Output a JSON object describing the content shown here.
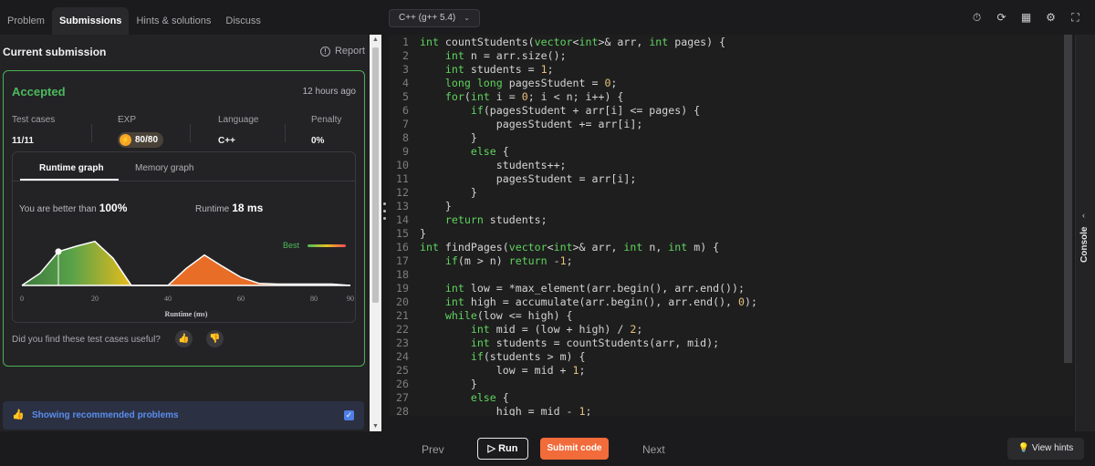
{
  "tabs": [
    {
      "label": "Problem"
    },
    {
      "label": "Submissions"
    },
    {
      "label": "Hints & solutions"
    },
    {
      "label": "Discuss"
    }
  ],
  "submission": {
    "title": "Current submission",
    "report": "Report",
    "status": "Accepted",
    "time": "12 hours ago",
    "stats": {
      "test_cases_label": "Test cases",
      "test_cases": "11/11",
      "exp_label": "EXP",
      "exp": "80/80",
      "language_label": "Language",
      "language": "C++",
      "penalty_label": "Penalty",
      "penalty": "0%"
    },
    "graph_tabs": [
      "Runtime graph",
      "Memory graph"
    ],
    "better_label": "You are better than",
    "better_value": "100%",
    "runtime_label": "Runtime",
    "runtime_value": "18 ms",
    "useful_question": "Did you find these test cases useful?",
    "recommend": "Showing recommended problems"
  },
  "chart_data": {
    "type": "area",
    "xlabel": "Runtime (ms)",
    "ylabel": "",
    "xlim": [
      0,
      90
    ],
    "x_ticks": [
      0,
      20,
      40,
      60,
      80,
      90
    ],
    "legend": "Best",
    "series": [
      {
        "x": [
          0,
          5,
          10,
          15,
          20,
          25,
          30,
          35,
          40,
          45,
          50,
          55,
          60,
          65,
          70,
          75,
          80,
          85,
          90
        ],
        "values": [
          0,
          18,
          50,
          58,
          65,
          40,
          0,
          0,
          0,
          25,
          45,
          28,
          12,
          3,
          2,
          2,
          2,
          2,
          0
        ]
      }
    ],
    "highlight": {
      "x": 10,
      "y": 50
    },
    "colors": {
      "green": "#4caf50",
      "yellow": "#e8c21f",
      "orange": "#f27127",
      "best": "#4cba5c"
    }
  },
  "editor": {
    "language": "C++ (g++ 5.4)",
    "lines": [
      "int countStudents(vector<int>& arr, int pages) {",
      "    int n = arr.size();",
      "    int students = 1;",
      "    long long pagesStudent = 0;",
      "    for(int i = 0; i < n; i++) {",
      "        if(pagesStudent + arr[i] <= pages) {",
      "            pagesStudent += arr[i];",
      "        }",
      "        else {",
      "            students++;",
      "            pagesStudent = arr[i];",
      "        }",
      "    }",
      "    return students;",
      "}",
      "int findPages(vector<int>& arr, int n, int m) {",
      "    if(m > n) return -1;",
      "",
      "    int low = *max_element(arr.begin(), arr.end());",
      "    int high = accumulate(arr.begin(), arr.end(), 0);",
      "    while(low <= high) {",
      "        int mid = (low + high) / 2;",
      "        int students = countStudents(arr, mid);",
      "        if(students > m) {",
      "            low = mid + 1;",
      "        }",
      "        else {",
      "            high = mid - 1;"
    ]
  },
  "console_label": "Console",
  "bottom": {
    "prev": "Prev",
    "run": "Run",
    "submit": "Submit code",
    "next": "Next",
    "hints": "View hints"
  }
}
